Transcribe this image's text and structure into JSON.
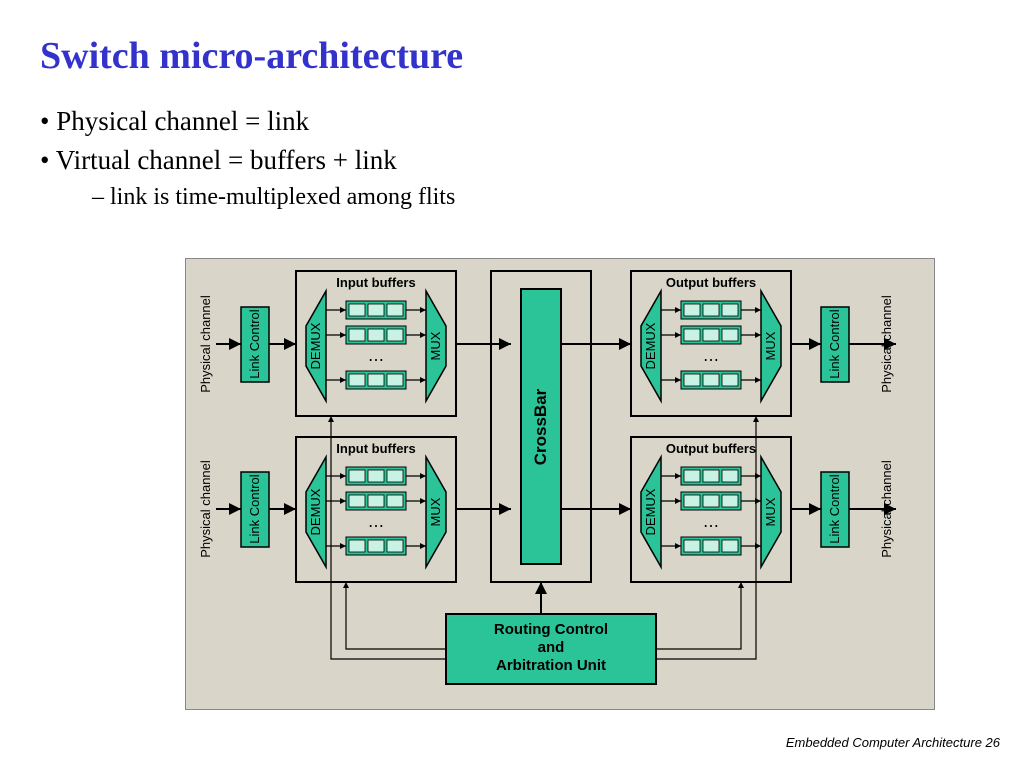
{
  "title": "Switch micro-architecture",
  "bullets": {
    "b1": "Physical channel = link",
    "b2": "Virtual channel   = buffers + link",
    "sub": "link is time-multiplexed among flits"
  },
  "diagram": {
    "phys_label": "Physical channel",
    "link_ctrl": "Link Control",
    "input_buf": "Input buffers",
    "output_buf": "Output buffers",
    "demux": "DEMUX",
    "mux": "MUX",
    "crossbar": "CrossBar",
    "routing1": "Routing Control",
    "routing2": "and",
    "routing3": "Arbitration Unit"
  },
  "footer": "Embedded Computer Architecture  26"
}
